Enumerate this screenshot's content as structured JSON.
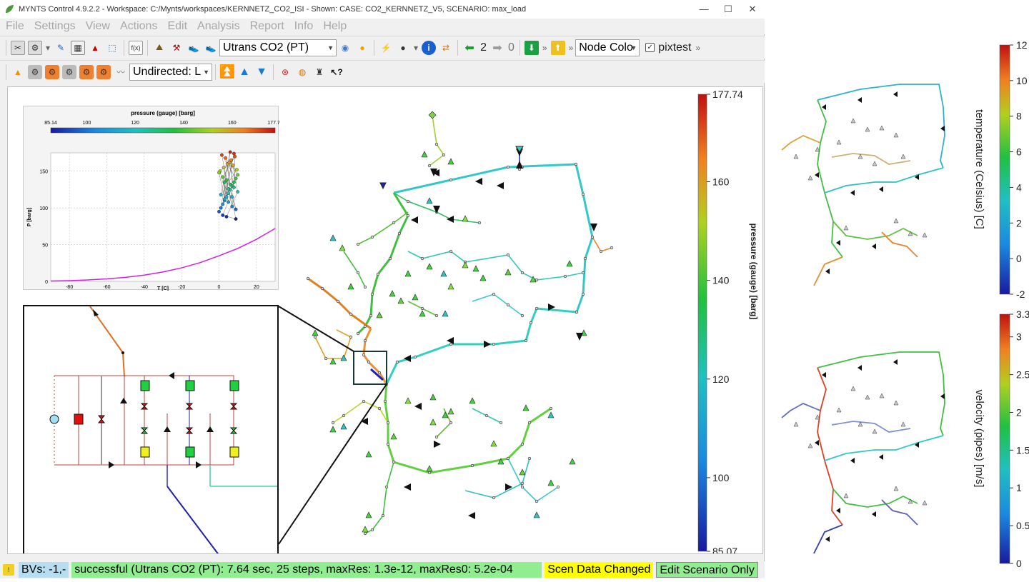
{
  "window": {
    "title": "MYNTS Control 4.9.2.2 - Workspace: C:/Mynts/workspaces/KERNNETZ_CO2_ISI - Shown: CASE: CO2_KERNNETZ_V5, SCENARIO: max_load",
    "minimize": "—",
    "maximize": "☐",
    "close": "✕"
  },
  "menu": [
    "File",
    "Settings",
    "View",
    "Actions",
    "Edit",
    "Analysis",
    "Report",
    "Info",
    "Help"
  ],
  "toolbar1": {
    "fx_label": "f(x)",
    "fluid_combo": "Utrans CO2 (PT)",
    "undo_count": "2",
    "redo_count": "0",
    "node_color_combo": "Node Colo",
    "pixtest_label": "pixtest",
    "more": "»"
  },
  "toolbar2": {
    "direction_combo": "Undirected: L"
  },
  "pt_chart": {
    "colorbar_title": "pressure (gauge) [barg]",
    "colorbar_ticks": [
      "85.14",
      "100",
      "120",
      "140",
      "160",
      "177.74"
    ],
    "xlabel": "T [C]",
    "ylabel": "P [barg]",
    "xticks": [
      "-80",
      "-60",
      "-40",
      "-20",
      "0",
      "20"
    ],
    "yticks": [
      "0",
      "50",
      "100",
      "150"
    ]
  },
  "chart_data": {
    "type": "scatter",
    "title": "pressure (gauge) [barg]",
    "xlabel": "T [C]",
    "ylabel": "P [barg]",
    "xlim": [
      -90,
      30
    ],
    "ylim": [
      0,
      175
    ],
    "grid": true,
    "series": [
      {
        "type": "line",
        "color": "#d21fe0",
        "x": [
          -90,
          -80,
          -70,
          -60,
          -50,
          -40,
          -30,
          -20,
          -10,
          0,
          10,
          20,
          30
        ],
        "y": [
          0.5,
          1,
          2,
          3.4,
          5.5,
          8.5,
          12.8,
          18.4,
          25.6,
          34.8,
          44.8,
          57.2,
          72
        ]
      },
      {
        "type": "scatter",
        "x": [
          0,
          1,
          2,
          3,
          4,
          5,
          6,
          7,
          8,
          9,
          10,
          0.5,
          2.5,
          4.5,
          6.5,
          8.5,
          1.5,
          3.5,
          5.5,
          7.5,
          9.5,
          0,
          2,
          4,
          6,
          8,
          10,
          1,
          3,
          5,
          7,
          9,
          2,
          4,
          6,
          8,
          3,
          5,
          7,
          9
        ],
        "y": [
          95,
          100,
          105,
          110,
          115,
          120,
          125,
          130,
          135,
          140,
          145,
          150,
          155,
          160,
          165,
          170,
          172,
          168,
          162,
          158,
          152,
          148,
          142,
          138,
          132,
          128,
          122,
          118,
          112,
          108,
          102,
          98,
          90,
          88,
          176,
          174,
          135,
          126,
          115,
          85
        ]
      }
    ]
  },
  "main_colorbar": {
    "label": "pressure (gauge) [barg]",
    "ticks": [
      "177.74",
      "160",
      "140",
      "120",
      "100",
      "85.07"
    ]
  },
  "temp_colorbar": {
    "label": "temperature (Celsius) [C]",
    "ticks": [
      "12",
      "10",
      "8",
      "6",
      "4",
      "2",
      "0",
      "-2"
    ]
  },
  "vel_colorbar": {
    "label": "velocity (pipes) [m/s]",
    "ticks": [
      "3.3",
      "3",
      "2.5",
      "2",
      "1.5",
      "1",
      "0.5",
      "0"
    ]
  },
  "status": {
    "bvs": "BVs: -1,-",
    "result": "successful (Utrans CO2 (PT): 7.64 sec, 25 steps, maxRes: 1.3e-12, maxRes0: 5.2e-04",
    "scen_changed": "Scen Data Changed",
    "edit_scenario": "Edit Scenario Only"
  },
  "colors": {
    "status_green": "#90ee90",
    "status_yellow": "#ffff00",
    "status_blue": "#b8dcf0",
    "accent_magenta": "#d21fe0"
  }
}
